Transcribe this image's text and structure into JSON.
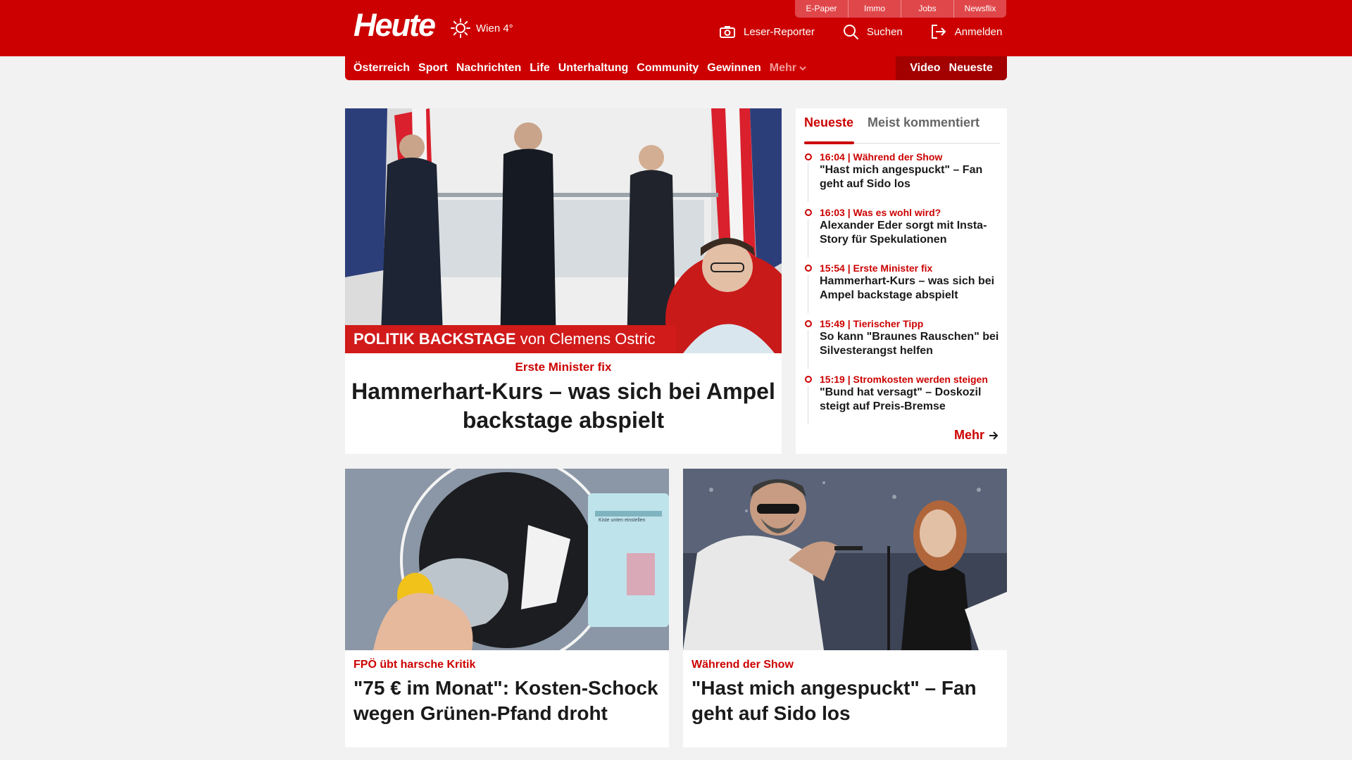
{
  "topbar": {
    "links": [
      "E-Paper",
      "Immo",
      "Jobs",
      "Newsflix"
    ]
  },
  "header": {
    "logo": "Heute",
    "weather": {
      "label": "Wien 4°",
      "icon": "sun-icon"
    },
    "actions": [
      {
        "label": "Leser-Reporter",
        "icon": "camera-icon"
      },
      {
        "label": "Suchen",
        "icon": "search-icon"
      },
      {
        "label": "Anmelden",
        "icon": "login-icon"
      }
    ]
  },
  "nav": {
    "items": [
      "Österreich",
      "Sport",
      "Nachrichten",
      "Life",
      "Unterhaltung",
      "Community",
      "Gewinnen"
    ],
    "more": "Mehr",
    "right": [
      "Video",
      "Neueste"
    ]
  },
  "hero": {
    "banner_bold": "POLITIK BACKSTAGE",
    "banner_rest": "von Clemens Ostric",
    "kicker": "Erste Minister fix",
    "title": "Hammerhart-Kurs – was sich bei Ampel backstage abspielt"
  },
  "sidebar": {
    "tabs": [
      "Neueste",
      "Meist kommentiert"
    ],
    "items": [
      {
        "meta": "16:04 | Während der Show",
        "title": "\"Hast mich angespuckt\" – Fan geht auf Sido los"
      },
      {
        "meta": "16:03 | Was es wohl wird?",
        "title": "Alexander Eder sorgt mit Insta-Story für Spekulationen"
      },
      {
        "meta": "15:54 | Erste Minister fix",
        "title": "Hammerhart-Kurs – was sich bei Ampel backstage abspielt"
      },
      {
        "meta": "15:49 | Tierischer Tipp",
        "title": "So kann \"Braunes Rauschen\" bei Silvesterangst helfen"
      },
      {
        "meta": "15:19 | Stromkosten werden steigen",
        "title": "\"Bund hat versagt\" – Doskozil steigt auf Preis-Bremse"
      }
    ],
    "more": "Mehr"
  },
  "cards": [
    {
      "kicker": "FPÖ übt harsche Kritik",
      "title": "\"75 € im Monat\": Kosten-Schock wegen Grünen-Pfand droht",
      "screen_text": "Kiste unten einstellen"
    },
    {
      "kicker": "Während der Show",
      "title": "\"Hast mich angespuckt\" – Fan geht auf Sido los"
    }
  ],
  "colors": {
    "brand": "#cc0000",
    "brand_dark": "#a30000",
    "page_bg": "#f2f2f2"
  }
}
